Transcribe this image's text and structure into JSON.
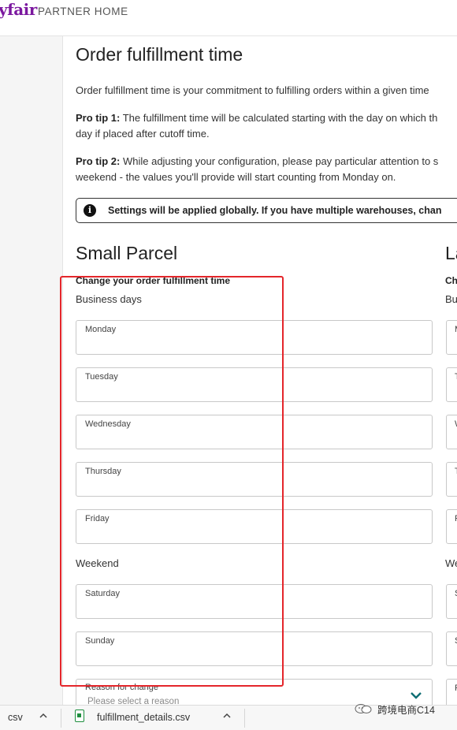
{
  "header": {
    "brand": "yfair",
    "subtitle": "PARTNER HOME"
  },
  "page": {
    "title": "Order fulfillment time",
    "intro": "Order fulfillment time is your commitment to fulfilling orders within a given time",
    "tip1_label": "Pro tip 1:",
    "tip1_line1": "The fulfillment time will be calculated starting with the day on which th",
    "tip1_line2": "day if placed after cutoff time.",
    "tip2_label": "Pro tip 2:",
    "tip2_line1": "While adjusting your configuration, please pay particular attention to s",
    "tip2_line2": "weekend - the values you'll provide will start counting from Monday on.",
    "notice_text": "Settings will be applied globally. If you have multiple warehouses, chan"
  },
  "small_parcel": {
    "title": "Small Parcel",
    "subheading": "Change your order fulfillment time",
    "business_days_label": "Business days",
    "weekend_label": "Weekend",
    "fields": {
      "monday": "Monday",
      "tuesday": "Tuesday",
      "wednesday": "Wednesday",
      "thursday": "Thursday",
      "friday": "Friday",
      "saturday": "Saturday",
      "sunday": "Sunday"
    },
    "reason_label": "Reason for change",
    "reason_placeholder": "Please select a reason"
  },
  "large_parcel_partial": {
    "title": "La",
    "subheading": "Ch",
    "business_days_label": "Bu",
    "weekend_label": "We",
    "field_initials": [
      "M",
      "T",
      "W",
      "T",
      "F",
      "S",
      "S",
      "R"
    ]
  },
  "downloads_bar": {
    "item1": "csv",
    "item2": "fulfillment_details.csv"
  },
  "watermark": "跨境电商C14",
  "colors": {
    "brand": "#7b189f",
    "highlight": "#e4262b",
    "chevron": "#0f6e74",
    "file_icon": "#1e8e3e"
  }
}
